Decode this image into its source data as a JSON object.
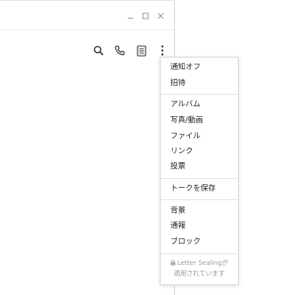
{
  "window": {
    "controls": [
      {
        "name": "minimize",
        "icon": "minimize-icon"
      },
      {
        "name": "maximize",
        "icon": "maximize-icon"
      },
      {
        "name": "close",
        "icon": "close-icon"
      }
    ]
  },
  "toolbar": {
    "icons": [
      "search-icon",
      "phone-icon",
      "notes-icon",
      "more-vertical-icon"
    ]
  },
  "menu": {
    "items": [
      {
        "label": "通知オフ"
      },
      {
        "label": "招待"
      },
      {
        "label": "アルバム"
      },
      {
        "label": "写真/動画"
      },
      {
        "label": "ファイル"
      },
      {
        "label": "リンク"
      },
      {
        "label": "投票"
      },
      {
        "label": "トークを保存"
      },
      {
        "label": "背景"
      },
      {
        "label": "通報"
      },
      {
        "label": "ブロック"
      }
    ],
    "footer": {
      "line1": "Letter Sealingが",
      "line2": "適用されています",
      "icon": "lock-icon"
    }
  },
  "colors": {
    "text": "#1e1e1e",
    "muted": "#9a9a9a",
    "icon": "#3a3a3a",
    "border": "#d9d9d9"
  }
}
